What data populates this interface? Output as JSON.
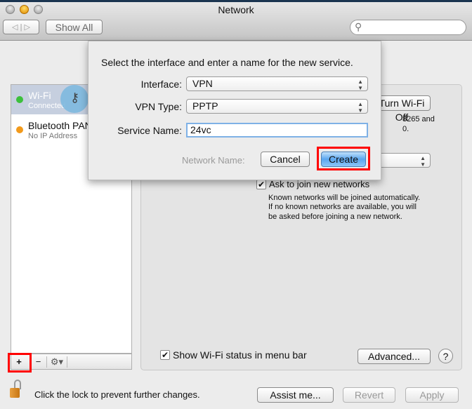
{
  "window": {
    "title": "Network",
    "show_all": "Show All",
    "search_placeholder": ""
  },
  "sidebar": {
    "items": [
      {
        "name": "Wi-Fi",
        "status": "Connected",
        "dot": "#3cc03c"
      },
      {
        "name": "Bluetooth PAN",
        "status": "No IP Address",
        "dot": "#f29a1b"
      }
    ]
  },
  "watermark": "24vc",
  "pane": {
    "turn_off": "Turn Wi-Fi Off",
    "status_fragment1": "8265 and",
    "status_fragment2": "0.",
    "network_name_label": "Network Name:",
    "ask_join": "Ask to join new networks",
    "ask_join_checked": true,
    "ask_desc": [
      "Known networks will be joined automatically.",
      "If no known networks are available, you will",
      "be asked before joining a new network."
    ],
    "show_status": "Show Wi-Fi status in menu bar",
    "show_status_checked": true,
    "advanced": "Advanced...",
    "help": "?"
  },
  "dialog": {
    "prompt": "Select the interface and enter a name for the new service.",
    "interface_label": "Interface:",
    "interface_value": "VPN",
    "vpn_type_label": "VPN Type:",
    "vpn_type_value": "PPTP",
    "service_name_label": "Service Name:",
    "service_name_value": "24vc",
    "cancel": "Cancel",
    "create": "Create"
  },
  "toolbar": {
    "add": "+",
    "remove": "−",
    "gear": "⚙▾"
  },
  "footer": {
    "lock_text": "Click the lock to prevent further changes.",
    "assist": "Assist me...",
    "revert": "Revert",
    "apply": "Apply"
  },
  "colors": {
    "highlight": "#ff0000",
    "accent": "#5aa6ef"
  }
}
